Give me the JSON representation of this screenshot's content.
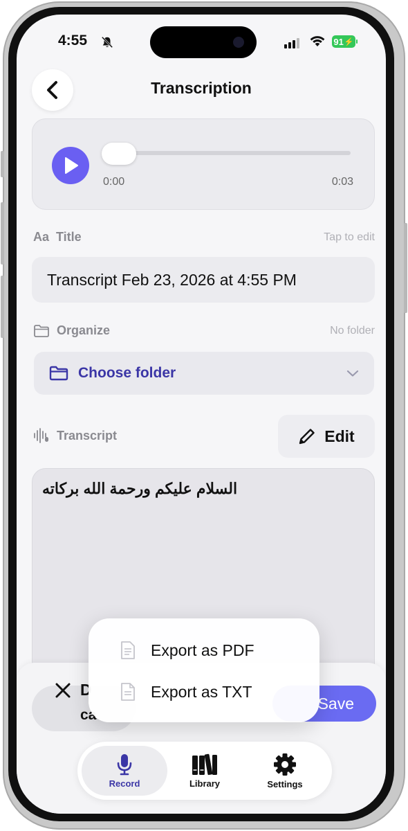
{
  "status_bar": {
    "time": "4:55",
    "battery": "91"
  },
  "header": {
    "title": "Transcription"
  },
  "player": {
    "current_time": "0:00",
    "total_time": "0:03",
    "progress": 0.0
  },
  "title_section": {
    "icon_text": "Aa",
    "label": "Title",
    "hint": "Tap to edit",
    "value": "Transcript Feb 23, 2026 at 4:55 PM"
  },
  "organize_section": {
    "label": "Organize",
    "hint": "No folder",
    "select_label": "Choose folder"
  },
  "transcript_section": {
    "label": "Transcript",
    "edit_label": "Edit",
    "text": "السلام عليكم ورحمة الله بركاته"
  },
  "actions": {
    "discard_line1": "D",
    "discard_line2": "ca",
    "save_label": "Save"
  },
  "export_menu": {
    "items": [
      "Export as PDF",
      "Export as TXT"
    ]
  },
  "tabs": [
    {
      "label": "Record",
      "icon": "microphone-icon",
      "active": true
    },
    {
      "label": "Library",
      "icon": "library-icon",
      "active": false
    },
    {
      "label": "Settings",
      "icon": "gear-icon",
      "active": false
    }
  ],
  "colors": {
    "accent": "#6a5ff2",
    "folder_text": "#3b36a6",
    "save": "#6a6bf2",
    "battery": "#34c759"
  }
}
